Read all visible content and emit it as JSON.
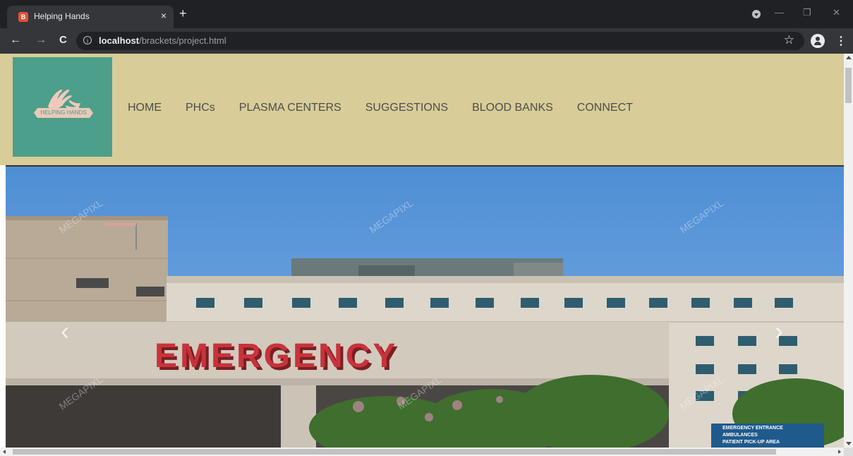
{
  "browser": {
    "tab_title": "Helping Hands",
    "tab_close": "×",
    "new_tab": "+",
    "url_host": "localhost",
    "url_path": "/brackets/project.html",
    "back": "←",
    "forward": "→",
    "reload": "C",
    "favicon_letter": "B",
    "star": "☆",
    "menu": "⋮",
    "window_minimize": "—",
    "window_restore": "❐",
    "window_close": "✕"
  },
  "site": {
    "logo_text": "HELPING HANDS",
    "nav": [
      "HOME",
      "PHCs",
      "PLASMA CENTERS",
      "SUGGESTIONS",
      "BLOOD BANKS",
      "CONNECT"
    ]
  },
  "hero": {
    "sign_text": "EMERGENCY",
    "signpost_lines": [
      "EMERGENCY ENTRANCE",
      "AMBULANCES",
      "PATIENT PICK-UP AREA"
    ],
    "watermark": "MEGAPIXL",
    "prev_arrow": "‹",
    "next_arrow": "›"
  },
  "colors": {
    "header_bg": "#d8cc98",
    "logo_bg": "#4c9f8a",
    "sky": "#5d97d8",
    "sign_red": "#c8333b"
  }
}
